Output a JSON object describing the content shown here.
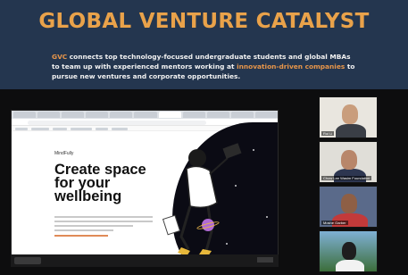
{
  "banner": {
    "title": "GLOBAL VENTURE CATALYST",
    "line1_prefix_hl": "GVC",
    "line1_rest": " connects top technology-focused undergraduate students and global MBAs",
    "line2_start": "to team up with experienced mentors working at ",
    "line2_hl": "innovation-driven companies",
    "line2_end": " to",
    "line3": "pursue new ventures and corporate opportunities.",
    "accent": "#e8964a",
    "background": "#24364f"
  },
  "shared_screen": {
    "brand": "MindFully",
    "headline": "Create space for your wellbeing",
    "tab_count": 11,
    "page_background": "#ffffff"
  },
  "participants": [
    {
      "name": "Rui Li",
      "icon": "video-feed"
    },
    {
      "name": "Chow Lee Wasim Foundation",
      "icon": "video-feed"
    },
    {
      "name": "Moshe Garber",
      "icon": "video-feed"
    },
    {
      "name": "",
      "icon": "video-feed"
    }
  ]
}
